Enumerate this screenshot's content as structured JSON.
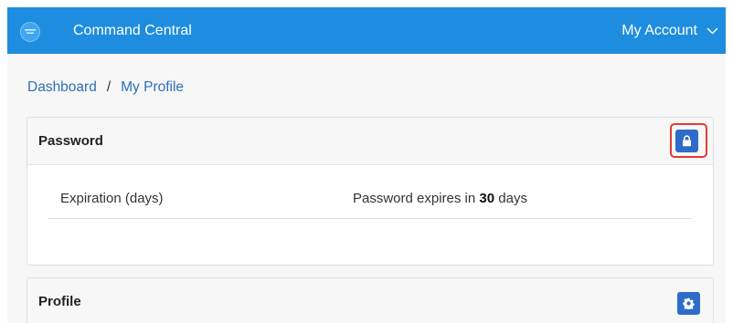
{
  "header": {
    "app_title": "Command Central",
    "account_label": "My Account",
    "logo_icon": "app-logo-icon",
    "chevron_icon": "chevron-down-icon",
    "brand_color": "#1e8ddf"
  },
  "breadcrumb": {
    "items": [
      {
        "label": "Dashboard"
      },
      {
        "label": "My Profile"
      }
    ],
    "separator": "/"
  },
  "password_card": {
    "title": "Password",
    "action_icon": "lock-icon",
    "row": {
      "label": "Expiration (days)",
      "value_prefix": "Password expires in",
      "value_days": "30",
      "value_suffix": "days"
    },
    "highlight_color": "#e53935"
  },
  "profile_card": {
    "title": "Profile",
    "action_icon": "gear-icon"
  },
  "colors": {
    "button": "#2e6cc9",
    "link": "#2d6fb7"
  }
}
